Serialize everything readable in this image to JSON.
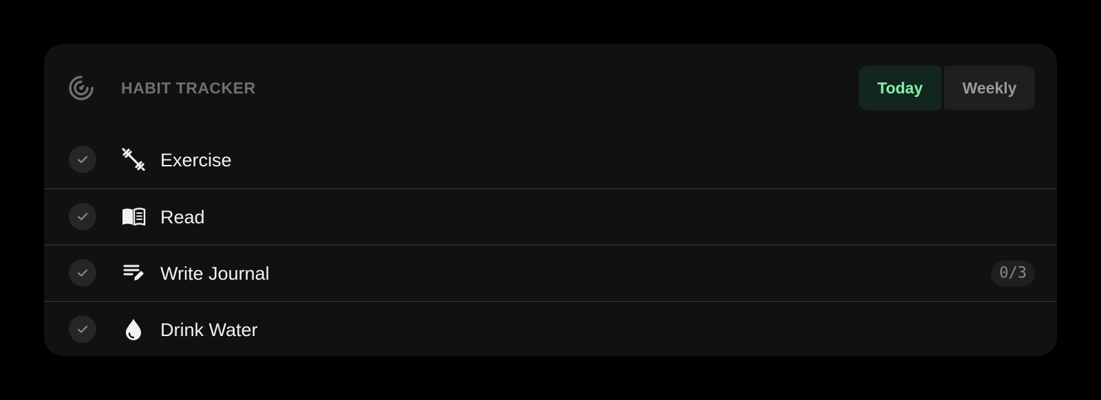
{
  "header": {
    "title": "HABIT TRACKER",
    "logo_icon": "target-icon"
  },
  "tabs": [
    {
      "label": "Today",
      "active": true
    },
    {
      "label": "Weekly",
      "active": false
    }
  ],
  "habits": [
    {
      "label": "Exercise",
      "icon": "dumbbell-icon",
      "count": ""
    },
    {
      "label": "Read",
      "icon": "book-icon",
      "count": ""
    },
    {
      "label": "Write Journal",
      "icon": "journal-pen-icon",
      "count": "0/3"
    },
    {
      "label": "Drink Water",
      "icon": "water-drop-icon",
      "count": ""
    }
  ],
  "colors": {
    "accent": "#86efac",
    "card": "#111111",
    "background": "#000000"
  }
}
